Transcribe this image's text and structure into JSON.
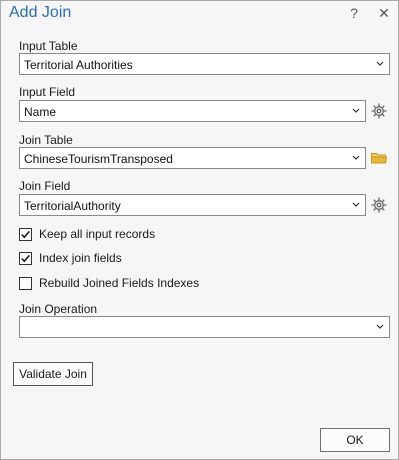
{
  "dialog": {
    "title": "Add Join",
    "help_label": "?",
    "close_label": "✕"
  },
  "input_table": {
    "label": "Input Table",
    "value": "Territorial Authorities"
  },
  "input_field": {
    "label": "Input Field",
    "value": "Name",
    "side_icon": "gear-icon"
  },
  "join_table": {
    "label": "Join Table",
    "value": "ChineseTourismTransposed",
    "side_icon": "folder-icon"
  },
  "join_field": {
    "label": "Join Field",
    "value": "TerritorialAuthority",
    "side_icon": "gear-icon"
  },
  "options": [
    {
      "label": "Keep all input records",
      "checked": true
    },
    {
      "label": "Index join fields",
      "checked": true
    },
    {
      "label": "Rebuild Joined Fields Indexes",
      "checked": false
    }
  ],
  "join_operation": {
    "label": "Join Operation",
    "value": ""
  },
  "buttons": {
    "validate_label": "Validate Join",
    "ok_label": "OK"
  },
  "colors": {
    "title": "#2a6fb6",
    "folder": "#e8b83a",
    "gear": "#666666"
  }
}
